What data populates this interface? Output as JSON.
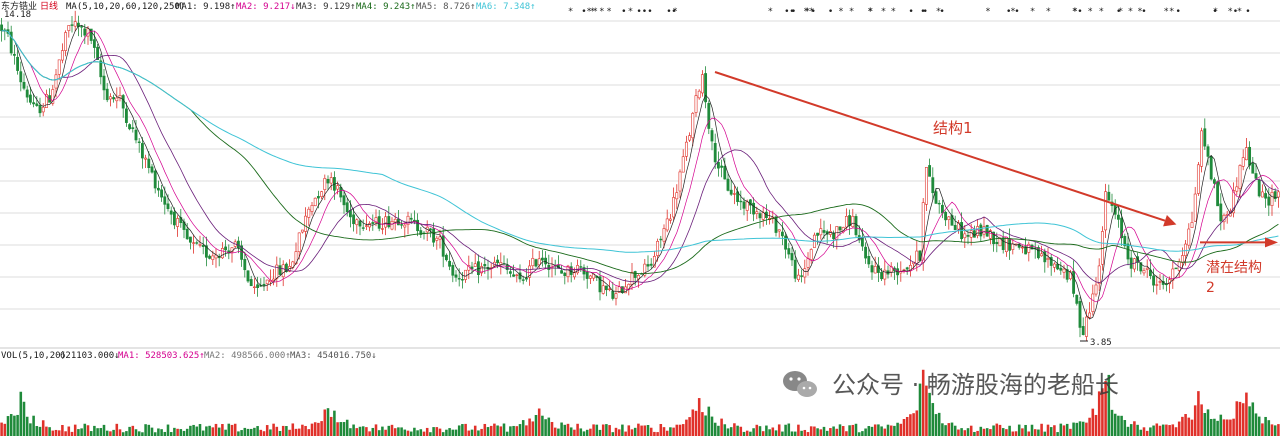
{
  "header": {
    "stock_name": "东方锆业",
    "period": "日线",
    "ma_setting": "MA(5,10,20,60,120,250)",
    "ma_values": [
      {
        "label": "MA1:",
        "value": "9.198",
        "arrow": "↑",
        "color": "#1f1f1f"
      },
      {
        "label": "MA2:",
        "value": "9.217",
        "arrow": "↓",
        "color": "#d4008f"
      },
      {
        "label": "MA3:",
        "value": "9.129",
        "arrow": "↑",
        "color": "#333333"
      },
      {
        "label": "MA4:",
        "value": "9.243",
        "arrow": "↑",
        "color": "#1a6a1a"
      },
      {
        "label": "MA5:",
        "value": "8.726",
        "arrow": "↑",
        "color": "#555555"
      },
      {
        "label": "MA6:",
        "value": "7.348",
        "arrow": "↑",
        "color": "#3fc4d6"
      }
    ]
  },
  "price_axis_top_label": "14.18",
  "low_marker_label": "3.85",
  "volume_header": {
    "setting": "VOL(5,10,20)",
    "value": "621103.000↓",
    "ma_values": [
      {
        "label": "MA1:",
        "value": "528503.625↑",
        "color": "#d4008f"
      },
      {
        "label": "MA2:",
        "value": "498566.000↑",
        "color": "#777777"
      },
      {
        "label": "MA3:",
        "value": "454016.750↓",
        "color": "#555555"
      }
    ]
  },
  "annotations": {
    "structure1": "结构1",
    "potential_line1": "潜在结构",
    "potential_line2": "2"
  },
  "watermark": {
    "text": "公众号 · 畅游股海的老船长"
  },
  "colors": {
    "up": "#e0312a",
    "down": "#1f8a3a",
    "annotation": "#d23a2a",
    "grid": "#dcdcdc",
    "ma_short": "#6a1f7a",
    "ma_medium": "#1a6a1a",
    "ma_long": "#3fc4d6"
  },
  "chart_data": {
    "type": "candlestick",
    "x_count": 400,
    "ylim": [
      3.85,
      14.18
    ],
    "price_path": [
      [
        0,
        14.0
      ],
      [
        8,
        13.6
      ],
      [
        20,
        12.3
      ],
      [
        35,
        11.2
      ],
      [
        50,
        11.7
      ],
      [
        70,
        14.1
      ],
      [
        90,
        13.7
      ],
      [
        105,
        11.8
      ],
      [
        120,
        11.6
      ],
      [
        140,
        10.0
      ],
      [
        165,
        8.3
      ],
      [
        190,
        6.9
      ],
      [
        210,
        6.6
      ],
      [
        235,
        6.9
      ],
      [
        255,
        5.3
      ],
      [
        272,
        6.0
      ],
      [
        290,
        6.2
      ],
      [
        310,
        8.2
      ],
      [
        330,
        9.2
      ],
      [
        350,
        7.8
      ],
      [
        375,
        7.6
      ],
      [
        400,
        7.8
      ],
      [
        425,
        7.4
      ],
      [
        440,
        7.0
      ],
      [
        455,
        5.9
      ],
      [
        475,
        6.1
      ],
      [
        500,
        6.3
      ],
      [
        520,
        5.7
      ],
      [
        540,
        6.6
      ],
      [
        560,
        6.0
      ],
      [
        580,
        6.2
      ],
      [
        600,
        5.6
      ],
      [
        615,
        5.2
      ],
      [
        630,
        5.9
      ],
      [
        650,
        6.2
      ],
      [
        672,
        8.1
      ],
      [
        690,
        10.6
      ],
      [
        702,
        12.5
      ],
      [
        712,
        10.1
      ],
      [
        725,
        8.9
      ],
      [
        740,
        8.3
      ],
      [
        760,
        8.0
      ],
      [
        780,
        7.4
      ],
      [
        800,
        5.6
      ],
      [
        815,
        7.3
      ],
      [
        835,
        7.3
      ],
      [
        852,
        7.8
      ],
      [
        865,
        6.4
      ],
      [
        880,
        6.0
      ],
      [
        905,
        6.2
      ],
      [
        920,
        6.6
      ],
      [
        925,
        9.5
      ],
      [
        935,
        8.4
      ],
      [
        950,
        7.7
      ],
      [
        965,
        7.2
      ],
      [
        985,
        7.4
      ],
      [
        1000,
        7.0
      ],
      [
        1020,
        6.9
      ],
      [
        1040,
        6.5
      ],
      [
        1060,
        6.2
      ],
      [
        1070,
        5.9
      ],
      [
        1082,
        4.1
      ],
      [
        1092,
        5.1
      ],
      [
        1100,
        6.6
      ],
      [
        1106,
        8.6
      ],
      [
        1118,
        7.6
      ],
      [
        1130,
        6.4
      ],
      [
        1145,
        6.1
      ],
      [
        1160,
        5.6
      ],
      [
        1172,
        5.9
      ],
      [
        1182,
        6.7
      ],
      [
        1192,
        7.7
      ],
      [
        1202,
        10.6
      ],
      [
        1212,
        9.1
      ],
      [
        1222,
        7.6
      ],
      [
        1232,
        8.3
      ],
      [
        1245,
        10.1
      ],
      [
        1256,
        8.9
      ],
      [
        1264,
        8.3
      ],
      [
        1280,
        8.7
      ]
    ],
    "low_point": {
      "value": 3.85
    },
    "trendline": {
      "from_price": 12.5,
      "to_price": 7.7
    },
    "potential_arrow_price": 7.0
  }
}
